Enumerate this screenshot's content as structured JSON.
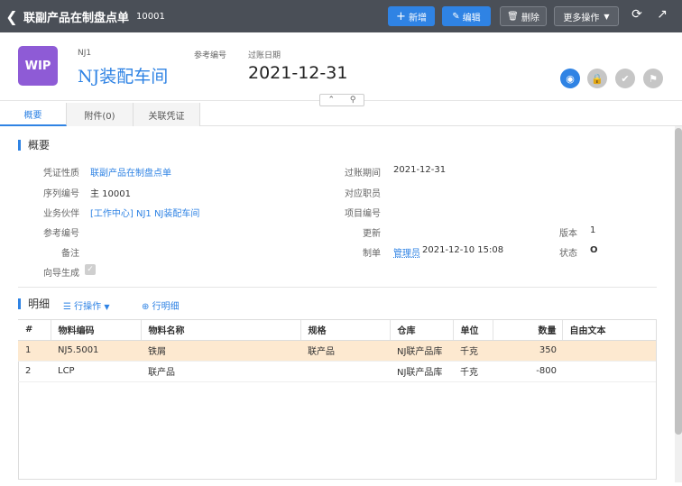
{
  "topbar": {
    "title": "联副产品在制盘点单",
    "doc_no": "10001",
    "buttons": {
      "new": "新增",
      "edit": "编辑",
      "delete": "删除",
      "more": "更多操作"
    }
  },
  "header": {
    "avatar": "WIP",
    "code": "NJ1",
    "name": "NJ装配车间",
    "ref_label": "参考编号",
    "date_label": "过账日期",
    "date": "2021-12-31"
  },
  "tabs": [
    "概要",
    "附件(0)",
    "关联凭证"
  ],
  "summary": {
    "title": "概要",
    "fields": {
      "voucher_type_label": "凭证性质",
      "voucher_type": "联副产品在制盘点单",
      "serial_label": "序列编号",
      "serial": "主 10001",
      "partner_label": "业务伙伴",
      "partner": "[工作中心] NJ1 NJ装配车间",
      "ref_label": "参考编号",
      "note_label": "备注",
      "wizard_label": "向导生成",
      "period_label": "过账期间",
      "period": "2021-12-31",
      "staff_label": "对应职员",
      "project_label": "项目编号",
      "update_label": "更新",
      "maker_label": "制单",
      "maker": "管理员",
      "maker_time": "2021-12-10 15:08",
      "version_label": "版本",
      "version": "1",
      "status_label": "状态",
      "status": "O"
    }
  },
  "detail": {
    "title": "明细",
    "row_ops": "行操作",
    "row_detail": "行明细",
    "columns": [
      "#",
      "物料编码",
      "物料名称",
      "规格",
      "仓库",
      "单位",
      "数量",
      "自由文本"
    ],
    "rows": [
      [
        "1",
        "NJ5.5001",
        "铁屑",
        "联产品",
        "NJ联产品库",
        "千克",
        "350",
        ""
      ],
      [
        "2",
        "LCP",
        "联产品",
        "",
        "NJ联产品库",
        "千克",
        "-800",
        ""
      ]
    ]
  },
  "colors": {
    "topbar": "#4a4f57",
    "accent": "#2f83e4",
    "avatar": "#8e5bd6",
    "selected_row": "#fde9d0"
  }
}
